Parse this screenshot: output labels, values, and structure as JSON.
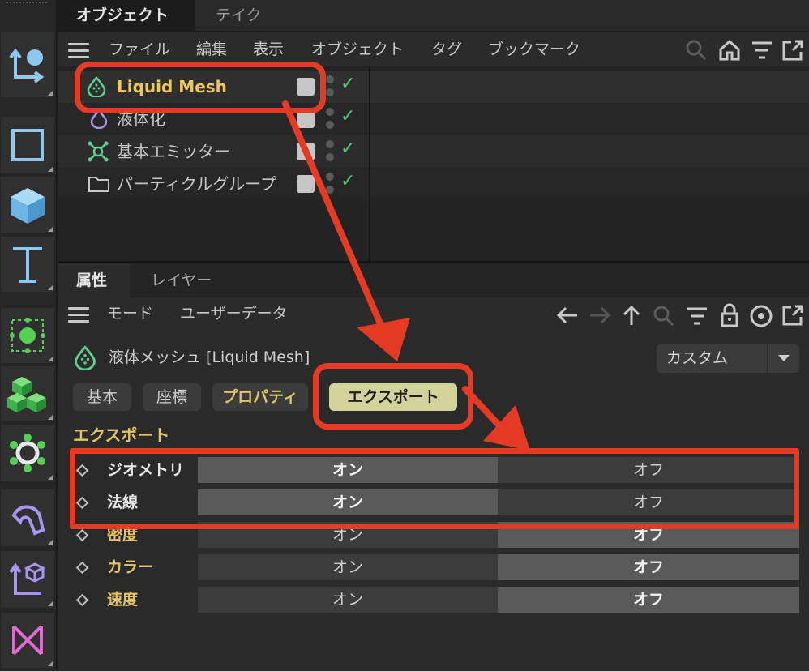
{
  "object_manager": {
    "tabs": [
      "オブジェクト",
      "テイク"
    ],
    "menu": [
      "ファイル",
      "編集",
      "表示",
      "オブジェクト",
      "タグ",
      "ブックマーク"
    ],
    "tree": [
      {
        "name": "Liquid Mesh",
        "icon": "liquid-mesh-icon",
        "highlighted": true
      },
      {
        "name": "液体化",
        "icon": "liquefy-icon"
      },
      {
        "name": "基本エミッター",
        "icon": "emitter-icon"
      },
      {
        "name": "パーティクルグループ",
        "icon": "folder-icon"
      }
    ]
  },
  "attribute_manager": {
    "tabs": [
      "属性",
      "レイヤー"
    ],
    "menu": [
      "モード",
      "ユーザーデータ"
    ],
    "object_title": "液体メッシュ [Liquid Mesh]",
    "preset_dropdown": "カスタム",
    "property_tabs": [
      "基本",
      "座標",
      "プロパティ",
      "エクスポート"
    ],
    "active_tab": "エクスポート",
    "section_title": "エクスポート",
    "rows": [
      {
        "label": "ジオメトリ",
        "on": "オン",
        "off": "オフ",
        "selected": "on"
      },
      {
        "label": "法線",
        "on": "オン",
        "off": "オフ",
        "selected": "on"
      },
      {
        "label": "密度",
        "on": "オン",
        "off": "オフ",
        "selected": "off"
      },
      {
        "label": "カラー",
        "on": "オン",
        "off": "オフ",
        "selected": "off"
      },
      {
        "label": "速度",
        "on": "オン",
        "off": "オフ",
        "selected": "off"
      }
    ]
  },
  "colors": {
    "annotation_red": "#e53b25",
    "label_gold": "#e2c466",
    "check_green": "#4bd16b",
    "active_tab": "#d2d39a"
  }
}
